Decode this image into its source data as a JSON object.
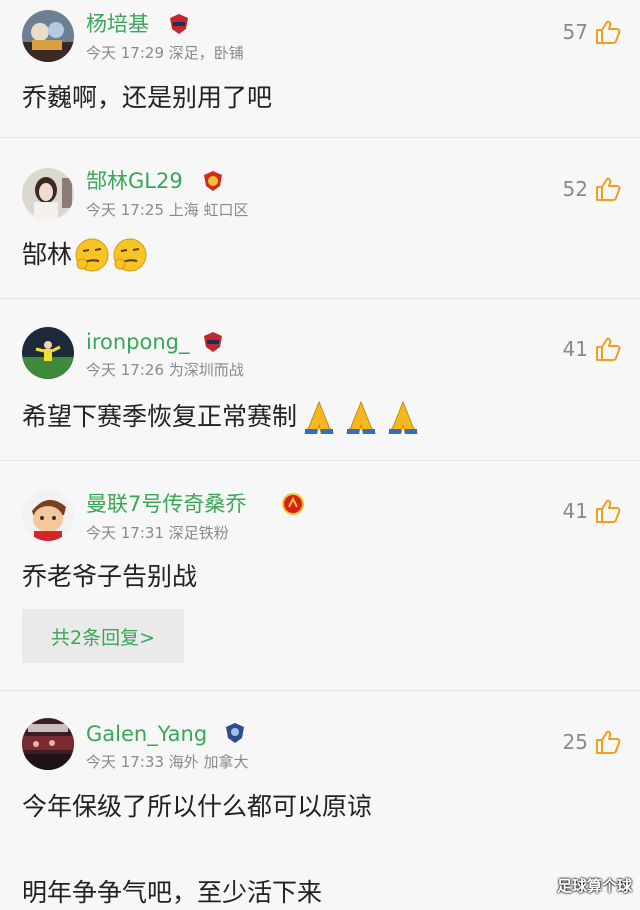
{
  "comments": [
    {
      "username": "杨培基",
      "meta": "今天 17:29 深足，卧铺",
      "likes": "57",
      "text": "乔巍啊，还是别用了吧",
      "avatar_icon": "bear-figurine-avatar",
      "badge_icon": "shenzhen-fc-badge-icon"
    },
    {
      "username": "郜林GL29",
      "meta": "今天 17:25 上海 虹口区",
      "likes": "52",
      "text": "郜林",
      "avatar_icon": "girl-photo-avatar",
      "badge_icon": "guangzhou-fc-badge-icon",
      "emojis": [
        "smirk-emoji",
        "smirk-emoji"
      ]
    },
    {
      "username": "ironpong_",
      "meta": "今天 17:26 为深圳而战",
      "likes": "41",
      "text": "希望下赛季恢复正常赛制",
      "avatar_icon": "soccer-player-avatar",
      "badge_icon": "shenzhen-fc-badge-icon",
      "emojis": [
        "praying-hands-emoji",
        "praying-hands-emoji",
        "praying-hands-emoji"
      ]
    },
    {
      "username": "曼联7号传奇桑乔",
      "meta": "今天 17:31 深足铁粉",
      "likes": "41",
      "text": "乔老爷子告别战",
      "replies_label": "共2条回复>",
      "avatar_icon": "cartoon-face-avatar",
      "badge_icon": "manchester-united-badge-icon"
    },
    {
      "username": "Galen_Yang",
      "meta": "今天 17:33 海外 加拿大",
      "likes": "25",
      "text": "今年保级了所以什么都可以原谅",
      "text2": "明年争争气吧，至少活下来",
      "avatar_icon": "stadium-crowd-avatar",
      "badge_icon": "club-shield-badge-icon"
    }
  ],
  "watermark": "足球算个球",
  "colors": {
    "username": "#3aa657",
    "meta": "#8a8a8a",
    "text": "#222222",
    "background": "#f7f7f7"
  }
}
